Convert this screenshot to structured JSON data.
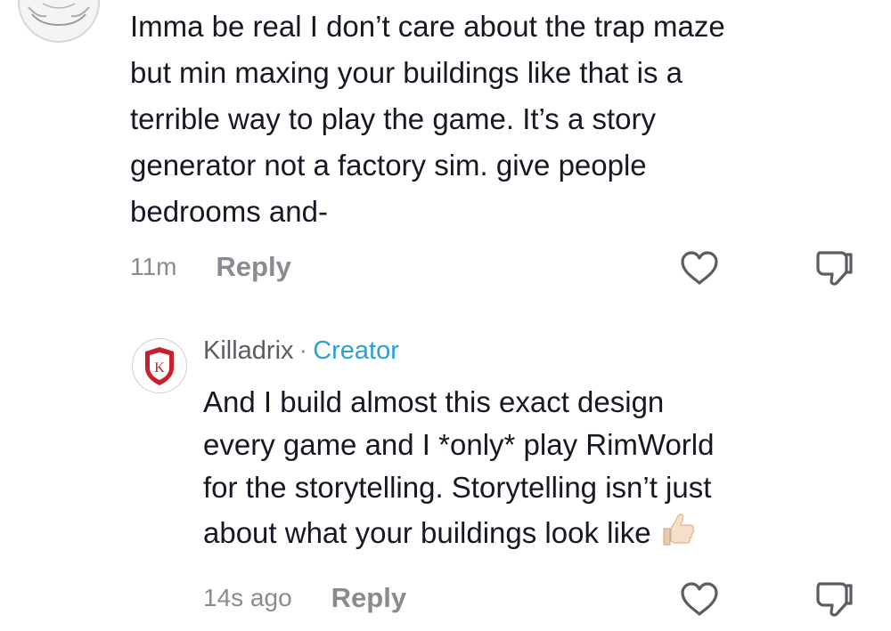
{
  "comments": [
    {
      "text": "Imma be real I don’t care about the trap maze\nbut min maxing your buildings like that is a\nterrible way to play the game. It’s a story\ngenerator not a factory sim. give people\nbedrooms and-",
      "time": "11m",
      "reply_label": "Reply"
    },
    {
      "author": "Killadrix",
      "separator": "·",
      "badge": "Creator",
      "avatar_letter": "K",
      "text": "And I build almost this exact design\nevery game and I *only* play RimWorld\nfor the storytelling. Storytelling isn’t just\nabout what your buildings look like",
      "emoji": "thumbs-up-emoji",
      "time": "14s ago",
      "reply_label": "Reply"
    }
  ],
  "icons": {
    "like": "heart-outline-icon",
    "dislike": "thumbs-down-outline-icon"
  },
  "colors": {
    "text": "#161823",
    "muted": "#8a8b91",
    "creator_badge": "#2c9fd4",
    "avatar_shield": "#c8202f"
  }
}
